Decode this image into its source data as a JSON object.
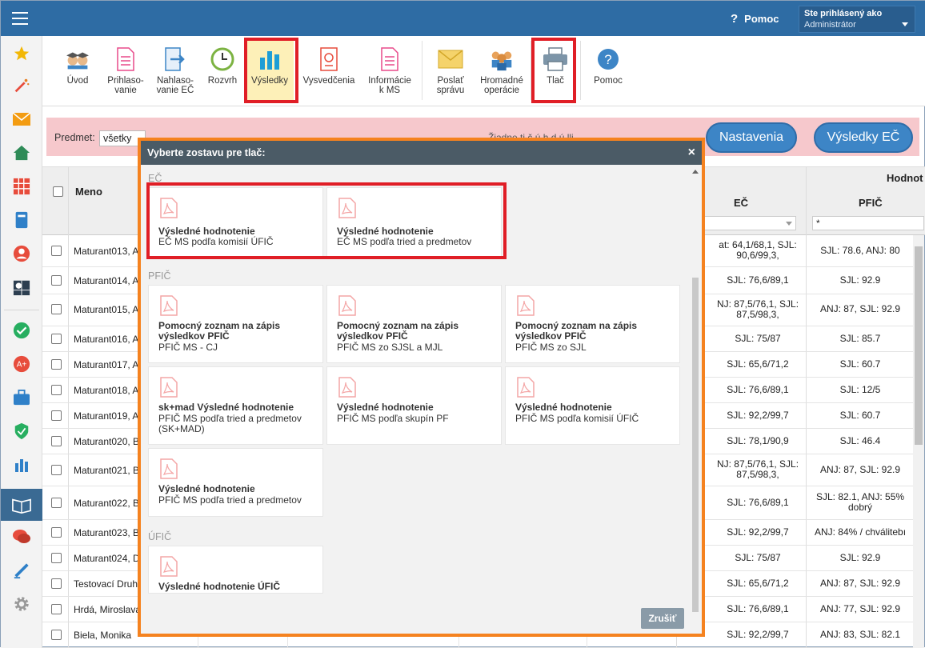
{
  "header": {
    "help_label": "Pomoc",
    "help_icon": "?",
    "user_line1": "Ste prihlásený ako",
    "user_line2": "Administrátor"
  },
  "toolbar": {
    "items": [
      {
        "label": "Úvod",
        "icon": "graduates-icon"
      },
      {
        "label": "Prihlaso-\nvanie",
        "icon": "form-icon"
      },
      {
        "label": "Nahlaso-\nvanie EČ",
        "icon": "export-icon"
      },
      {
        "label": "Rozvrh",
        "icon": "clock-icon"
      },
      {
        "label": "Výsledky",
        "icon": "bar-chart-icon"
      },
      {
        "label": "Vysvedčenia",
        "icon": "certificate-icon"
      },
      {
        "label": "Informácie\nk MS",
        "icon": "info-doc-icon"
      },
      {
        "label": "Poslať\nsprávu",
        "icon": "envelope-icon"
      },
      {
        "label": "Hromadné\noperácie",
        "icon": "people-icon"
      },
      {
        "label": "Tlač",
        "icon": "printer-icon"
      },
      {
        "label": "Pomoc",
        "icon": "help-icon"
      }
    ]
  },
  "filter": {
    "subject_label": "Predmet:",
    "subject_value": "všetky",
    "hint": "Žiadne ti  č  ú h d  ú  lli     ."
  },
  "buttons": {
    "settings": "Nastavenia",
    "results_ec": "Výsledky EČ"
  },
  "table": {
    "col_name": "Meno",
    "group_header": "Hodnot",
    "col_ec": "EČ",
    "col_pfic": "PFIČ",
    "pfic_filter_value": "*",
    "rows": [
      {
        "name": "Maturant013, A",
        "ec": "at: 64,1/68,1, SJL: 90,6/99,3,",
        "pf": "SJL: 78.6, ANJ: 80"
      },
      {
        "name": "Maturant014, A",
        "ec": "SJL: 76,6/89,1",
        "pf": "SJL: 92.9"
      },
      {
        "name": "Maturant015, A",
        "ec": "NJ: 87,5/76,1, SJL: 87,5/98,3,",
        "pf": "ANJ: 87, SJL: 92.9"
      },
      {
        "name": "Maturant016, A",
        "ec": "SJL: 75/87",
        "pf": "SJL: 85.7"
      },
      {
        "name": "Maturant017, A",
        "ec": "SJL: 65,6/71,2",
        "pf": "SJL: 60.7"
      },
      {
        "name": "Maturant018, A",
        "ec": "SJL: 76,6/89,1",
        "pf": "SJL: 12/5"
      },
      {
        "name": "Maturant019, A",
        "ec": "SJL: 92,2/99,7",
        "pf": "SJL: 60.7"
      },
      {
        "name": "Maturant020, B",
        "ec": "SJL: 78,1/90,9",
        "pf": "SJL: 46.4"
      },
      {
        "name": "Maturant021, B",
        "ec": "NJ: 87,5/76,1, SJL: 87,5/98,3,",
        "pf": "ANJ: 87, SJL: 92.9"
      },
      {
        "name": "Maturant022, B",
        "ec": "SJL: 76,6/89,1",
        "pf": "SJL: 82.1, ANJ: 55% dobrý"
      },
      {
        "name": "Maturant023, B",
        "ec": "SJL: 92,2/99,7",
        "pf": "ANJ: 84% / chválitebı"
      },
      {
        "name": "Maturant024, D",
        "ec": "SJL: 75/87",
        "pf": "SJL: 92.9"
      },
      {
        "name": "Testovací Druh",
        "ec": "SJL: 65,6/71,2",
        "pf": "ANJ: 87, SJL: 92.9"
      },
      {
        "name": "Hrdá, Miroslava",
        "ec": "SJL: 76,6/89,1",
        "pf": "ANJ: 77, SJL: 92.9"
      },
      {
        "name": "Biela, Monika",
        "ec": "SJL: 92,2/99,7",
        "pf": "ANJ: 83, SJL: 82.1"
      }
    ]
  },
  "modal": {
    "title": "Vyberte zostavu pre tlač:",
    "close": "×",
    "cancel": "Zrušiť",
    "sections": [
      {
        "label": "EČ",
        "cards": [
          {
            "title": "Výsledné hodnotenie",
            "subtitle": "EČ MS podľa komisií ÚFIČ"
          },
          {
            "title": "Výsledné hodnotenie",
            "subtitle": "EČ MS podľa tried a predmetov"
          }
        ]
      },
      {
        "label": "PFIČ",
        "cards": [
          {
            "title": "Pomocný zoznam na zápis výsledkov PFIČ",
            "subtitle": "PFIČ MS - CJ"
          },
          {
            "title": "Pomocný zoznam na zápis výsledkov PFIČ",
            "subtitle": "PFIČ MS zo SJSL a MJL"
          },
          {
            "title": "Pomocný zoznam na zápis výsledkov PFIČ",
            "subtitle": "PFIČ MS zo SJL"
          },
          {
            "title": "sk+mad Výsledné hodnotenie",
            "subtitle": "PFIČ MS podľa tried a predmetov (SK+MAD)"
          },
          {
            "title": "Výsledné hodnotenie",
            "subtitle": "PFIČ MS podľa skupín PF"
          },
          {
            "title": "Výsledné hodnotenie",
            "subtitle": "PFIČ MS podľa komisií ÚFIČ"
          },
          {
            "title": "Výsledné hodnotenie",
            "subtitle": "PFIČ MS podľa tried a predmetov"
          }
        ]
      },
      {
        "label": "ÚFIČ",
        "cards": [
          {
            "title": "Výsledné hodnotenie ÚFIČ",
            "subtitle": ""
          }
        ]
      }
    ]
  },
  "sidebar": {
    "icons": [
      "star-icon",
      "magic-wand-icon",
      "envelope-icon",
      "home-icon",
      "calendar-grid-icon",
      "book-icon",
      "user-icon",
      "schedule-icon",
      "check-circle-icon",
      "badge-icon",
      "briefcase-icon",
      "shield-icon",
      "bar-chart-icon",
      "open-book-icon",
      "chat-icon",
      "pen-icon",
      "gear-icon"
    ]
  },
  "colors": {
    "header": "#2e6ca4",
    "accent_red": "#e01e26",
    "modal_border": "#f5821f",
    "filter_bg": "#f6c8cc",
    "button_blue": "#3d85c6"
  }
}
